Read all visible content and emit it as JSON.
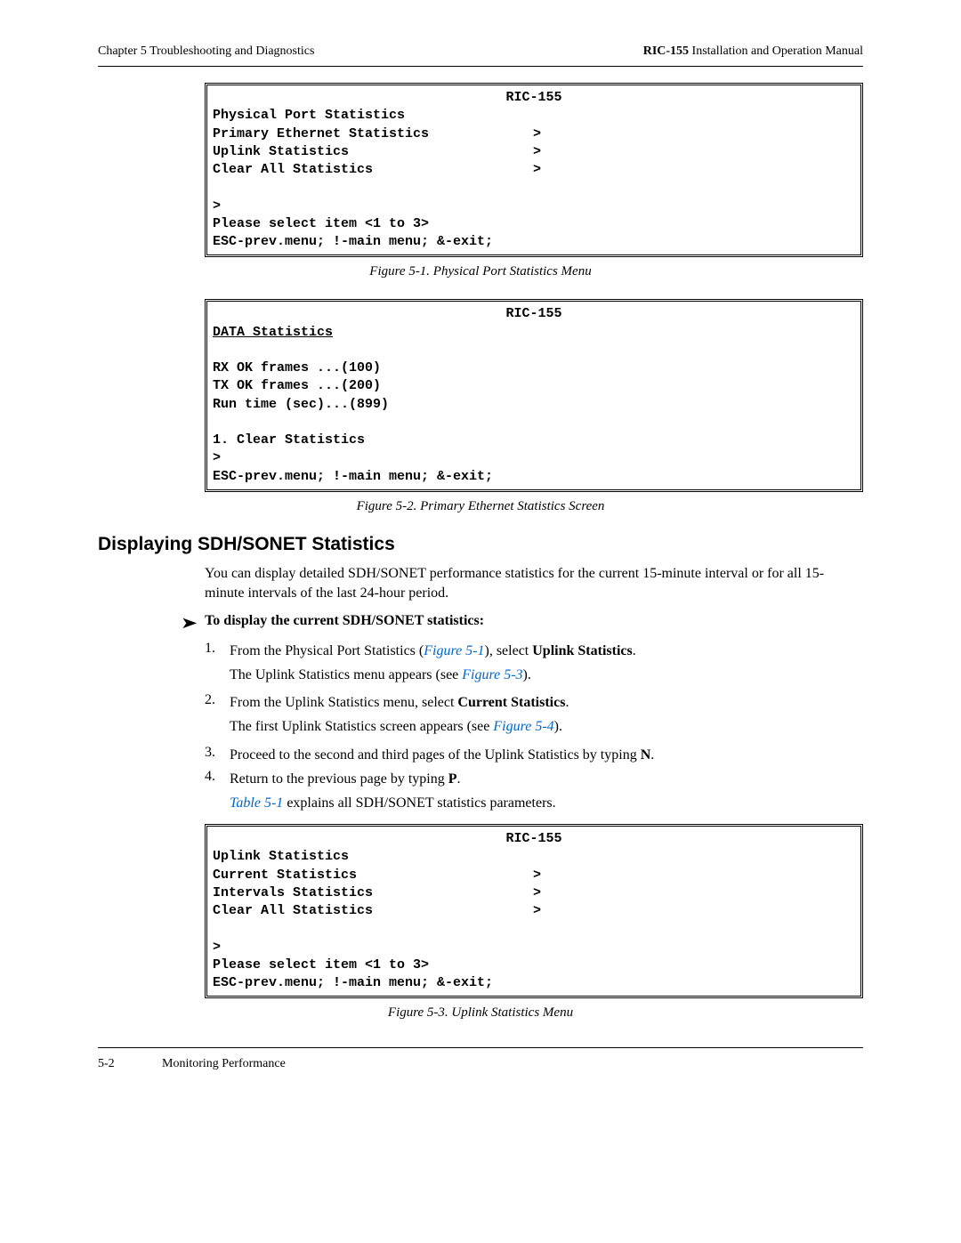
{
  "header": {
    "left_chapter": "Chapter 5  Troubleshooting and Diagnostics",
    "right_product": "RIC-155",
    "right_suffix": " Installation and Operation Manual"
  },
  "terminal1": {
    "title": "RIC-155",
    "heading": "Physical Port Statistics",
    "row1": "Primary Ethernet Statistics",
    "row2": "Uplink Statistics",
    "row3": "Clear All Statistics",
    "arrow": ">",
    "prompt": ">",
    "select": "Please select item <1 to 3>",
    "nav": "ESC-prev.menu; !-main menu; &-exit;"
  },
  "caption1": "Figure 5-1.  Physical Port Statistics Menu",
  "terminal2": {
    "title": "RIC-155",
    "heading": "DATA Statistics",
    "rx": "RX OK frames  ...(100)",
    "tx": "TX OK frames  ...(200)",
    "run": "Run time (sec)...(899)",
    "clear": "1. Clear Statistics",
    "prompt": ">",
    "nav": "ESC-prev.menu; !-main menu; &-exit;"
  },
  "caption2": "Figure 5-2.  Primary Ethernet Statistics Screen",
  "section": {
    "heading": "Displaying SDH/SONET Statistics",
    "intro": "You can display detailed SDH/SONET performance statistics for the current 15-minute interval or for all 15-minute intervals of the last 24-hour period.",
    "procedure_title": "To display the current SDH/SONET statistics:",
    "step1_a": "From the Physical Port Statistics (",
    "step1_link": "Figure 5-1",
    "step1_b": "), select ",
    "step1_bold": "Uplink Statistics",
    "step1_c": ".",
    "step1_sub_a": "The Uplink Statistics menu appears (see ",
    "step1_sub_link": "Figure 5-3",
    "step1_sub_b": ").",
    "step2_a": "From the Uplink Statistics menu, select ",
    "step2_bold": "Current Statistics",
    "step2_b": ".",
    "step2_sub_a": "The first Uplink Statistics screen appears (see ",
    "step2_sub_link": "Figure 5-4",
    "step2_sub_b": ").",
    "step3_a": "Proceed to the second and third pages of the Uplink Statistics by typing ",
    "step3_bold": "N",
    "step3_b": ".",
    "step4_a": "Return to the previous page by typing ",
    "step4_bold": "P",
    "step4_b": ".",
    "step4_sub_link": "Table 5-1",
    "step4_sub_a": " explains all SDH/SONET statistics parameters."
  },
  "terminal3": {
    "title": "RIC-155",
    "heading": "Uplink Statistics",
    "row1": "Current Statistics",
    "row2": "Intervals Statistics",
    "row3": "Clear All Statistics",
    "arrow": ">",
    "prompt": ">",
    "select": "Please select item <1 to 3>",
    "nav": "ESC-prev.menu; !-main menu; &-exit;"
  },
  "caption3": "Figure 5-3.  Uplink Statistics Menu",
  "footer": {
    "page": "5-2",
    "section": "Monitoring Performance"
  }
}
